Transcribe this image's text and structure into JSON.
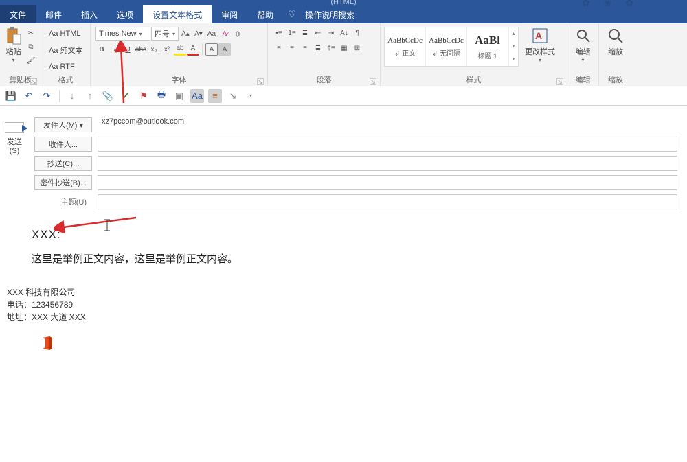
{
  "titlebar": {
    "title": "(HTML)"
  },
  "menu": {
    "file": "文件",
    "mail": "邮件",
    "insert": "插入",
    "options": "选项",
    "format": "设置文本格式",
    "review": "审阅",
    "help": "帮助",
    "tell": "操作说明搜索"
  },
  "ribbon": {
    "clipboard": {
      "title": "剪贴板",
      "paste": "粘贴"
    },
    "format_gp": {
      "title": "格式",
      "html": "Aa HTML",
      "plain": "Aa 纯文本",
      "rtf": "Aa RTF"
    },
    "font": {
      "title": "字体",
      "name": "Times New",
      "size": "四号"
    },
    "para": {
      "title": "段落"
    },
    "styles": {
      "title": "样式",
      "s1": {
        "sample": "AaBbCcDc",
        "name": "↲ 正文"
      },
      "s2": {
        "sample": "AaBbCcDc",
        "name": "↲ 无间隔"
      },
      "s3": {
        "sample": "AaBl",
        "name": "标题 1"
      },
      "change": "更改样式"
    },
    "edit": {
      "title": "编辑",
      "label": "编辑"
    },
    "zoom": {
      "title": "缩放",
      "label": "缩放"
    }
  },
  "compose": {
    "send": "发送",
    "send_key": "(S)",
    "from_btn": "发件人(M) ▾",
    "from_val": "xz7pccom@outlook.com",
    "to": "收件人...",
    "cc": "抄送(C)...",
    "bcc": "密件抄送(B)...",
    "subject_lab": "主题(U)"
  },
  "body": {
    "greet": "XXX:",
    "para1": "这里是举例正文内容，这里是举例正文内容。"
  },
  "sig": {
    "l1": "XXX 科技有限公司",
    "l2": "电话：123456789",
    "l3": "地址：XXX 大道 XXX"
  }
}
